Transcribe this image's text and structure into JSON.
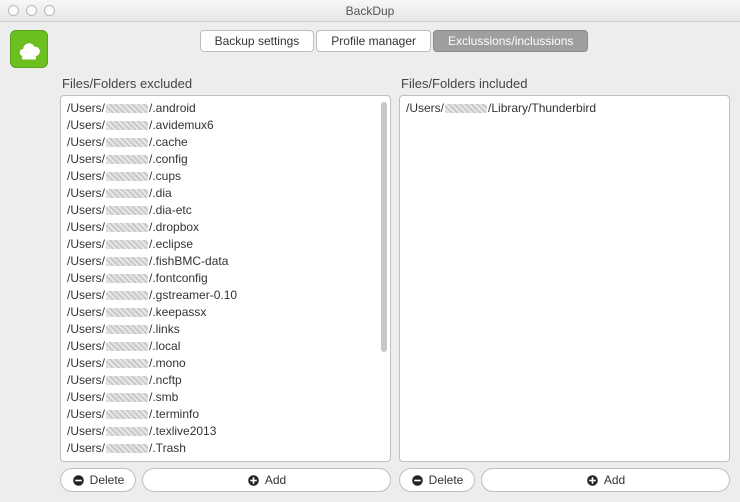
{
  "window": {
    "title": "BackDup"
  },
  "tabs": [
    {
      "label": "Backup settings",
      "active": false
    },
    {
      "label": "Profile manager",
      "active": false
    },
    {
      "label": "Exclussions/inclussions",
      "active": true
    }
  ],
  "excluded": {
    "heading": "Files/Folders excluded",
    "prefix": "/Users/",
    "items": [
      "/.android",
      "/.avidemux6",
      "/.cache",
      "/.config",
      "/.cups",
      "/.dia",
      "/.dia-etc",
      "/.dropbox",
      "/.eclipse",
      "/.fishBMC-data",
      "/.fontconfig",
      "/.gstreamer-0.10",
      "/.keepassx",
      "/.links",
      "/.local",
      "/.mono",
      "/.ncftp",
      "/.smb",
      "/.terminfo",
      "/.texlive2013",
      "/.Trash"
    ]
  },
  "included": {
    "heading": "Files/Folders included",
    "prefix": "/Users/",
    "items": [
      "/Library/Thunderbird"
    ]
  },
  "buttons": {
    "delete": "Delete",
    "add": "Add"
  }
}
